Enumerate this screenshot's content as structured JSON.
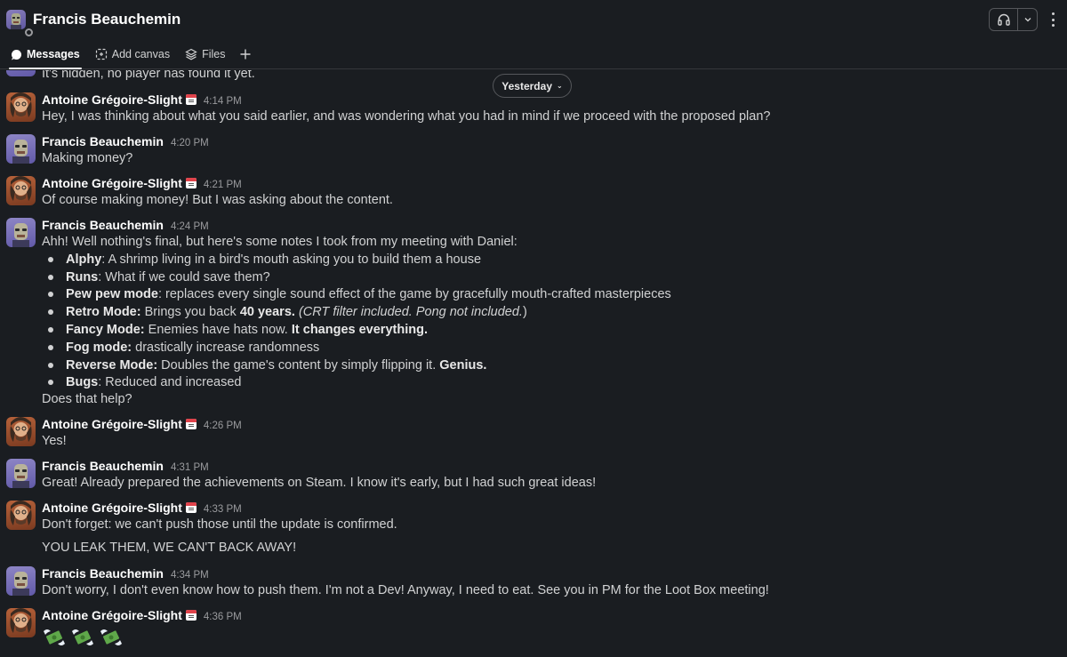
{
  "channel": {
    "title": "Francis Beauchemin"
  },
  "tabs": [
    {
      "label": "Messages",
      "icon": "chat-bubble-icon",
      "active": true
    },
    {
      "label": "Add canvas",
      "icon": "canvas-icon",
      "active": false
    },
    {
      "label": "Files",
      "icon": "layers-icon",
      "active": false
    }
  ],
  "day_divider": {
    "label": "Yesterday"
  },
  "messages": [
    {
      "text": "It's hidden, no player has found it yet."
    },
    {
      "author": "Antoine Grégoire-Slight",
      "time": "4:14 PM",
      "status_emoji": "calendar",
      "text": "Hey, I was thinking about what you said earlier, and was wondering what you had in mind if we proceed with the proposed plan?"
    },
    {
      "author": "Francis Beauchemin",
      "time": "4:20 PM",
      "text": "Making money?"
    },
    {
      "author": "Antoine Grégoire-Slight",
      "time": "4:21 PM",
      "status_emoji": "calendar",
      "text": "Of course making money! But I was asking about the content."
    },
    {
      "author": "Francis Beauchemin",
      "time": "4:24 PM",
      "text": "Ahh! Well nothing's final, but here's some notes I took from my meeting with Daniel:",
      "bullets": [
        {
          "bold": "Alphy",
          "rest": ": A shrimp living in a bird's mouth asking you to build them a house"
        },
        {
          "bold": "Runs",
          "rest": ": What if we could save them?"
        },
        {
          "bold": "Pew pew mode",
          "rest": ": replaces every single sound effect of the game by gracefully mouth-crafted masterpieces"
        },
        {
          "bold": "Retro Mode:",
          "rest": " Brings you back ",
          "bold2": "40 years.",
          "italic": "(CRT filter included. Pong not included.",
          "tail": ")"
        },
        {
          "bold": "Fancy Mode:",
          "rest": " Enemies have hats now. ",
          "bold2": "It changes everything."
        },
        {
          "bold": "Fog mode:",
          "rest": " drastically increase randomness"
        },
        {
          "bold": "Reverse Mode:",
          "rest": " Doubles the game's content by simply flipping it. ",
          "bold2": "Genius."
        },
        {
          "bold": "Bugs",
          "rest": ": Reduced and increased"
        }
      ],
      "after": "Does that help?"
    },
    {
      "author": "Antoine Grégoire-Slight",
      "time": "4:26 PM",
      "status_emoji": "calendar",
      "text": "Yes!"
    },
    {
      "author": "Francis Beauchemin",
      "time": "4:31 PM",
      "text": "Great! Already prepared the achievements on Steam. I know it's early, but I had such great ideas!"
    },
    {
      "author": "Antoine Grégoire-Slight",
      "time": "4:33 PM",
      "status_emoji": "calendar",
      "text": "Don't forget: we can't push those until the update is confirmed.",
      "text2": "YOU LEAK THEM, WE CAN'T BACK AWAY!"
    },
    {
      "author": "Francis Beauchemin",
      "time": "4:34 PM",
      "text": "Don't worry, I don't even know how to push them. I'm not a Dev! Anyway, I need to eat. See you in PM for the Loot Box meeting!"
    },
    {
      "author": "Antoine Grégoire-Slight",
      "time": "4:36 PM",
      "status_emoji": "calendar",
      "emojis": [
        "money-with-wings",
        "money-with-wings",
        "money-with-wings"
      ]
    }
  ]
}
